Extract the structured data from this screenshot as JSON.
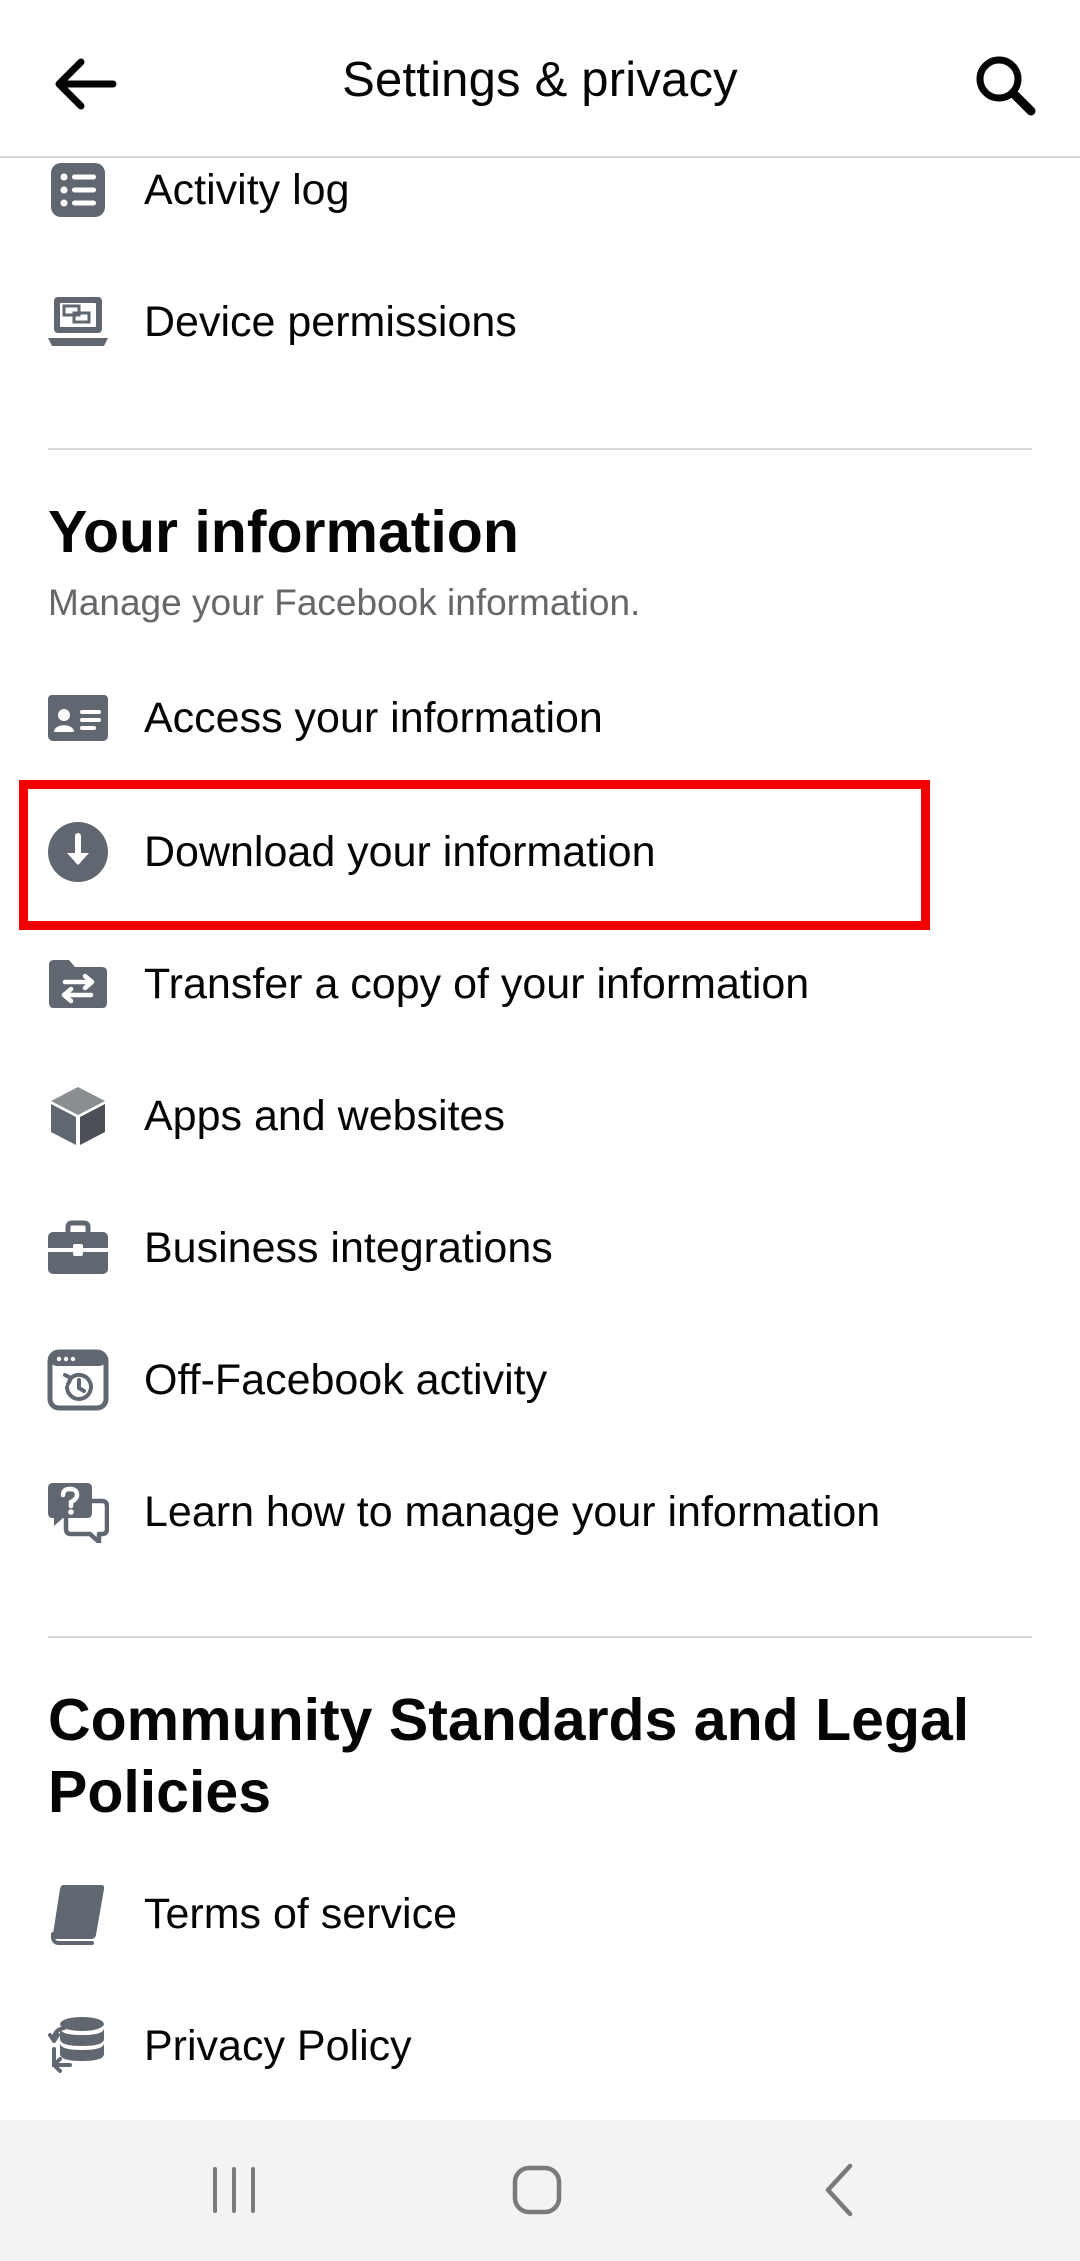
{
  "header": {
    "title": "Settings & privacy",
    "back_icon": "arrow-left-icon",
    "search_icon": "search-icon"
  },
  "top_items": [
    {
      "label": "Activity log",
      "icon": "list-icon"
    },
    {
      "label": "Device permissions",
      "icon": "laptop-icon"
    }
  ],
  "your_information": {
    "title": "Your information",
    "subtitle": "Manage your Facebook information.",
    "items": [
      {
        "label": "Access your information",
        "icon": "id-card-icon"
      },
      {
        "label": "Download your information",
        "icon": "download-circle-icon"
      },
      {
        "label": "Transfer a copy of your information",
        "icon": "folder-transfer-icon"
      },
      {
        "label": "Apps and websites",
        "icon": "cube-icon"
      },
      {
        "label": "Business integrations",
        "icon": "briefcase-icon"
      },
      {
        "label": "Off-Facebook activity",
        "icon": "history-window-icon"
      },
      {
        "label": "Learn how to manage your information",
        "icon": "help-chat-icon"
      }
    ]
  },
  "community": {
    "title_line1": "Community Standards and Legal",
    "title_line2": "Policies",
    "items": [
      {
        "label": "Terms of service",
        "icon": "book-icon"
      },
      {
        "label": "Privacy Policy",
        "icon": "database-sync-icon"
      }
    ]
  },
  "system_nav": {
    "recents_icon": "recents-icon",
    "home_icon": "home-icon",
    "back_icon": "back-chevron-icon"
  },
  "colors": {
    "icon": "#606770",
    "highlight": "#f20000",
    "subtext": "#65676b",
    "divider": "#d9d9d9",
    "navbar": "#f3f3f3"
  }
}
